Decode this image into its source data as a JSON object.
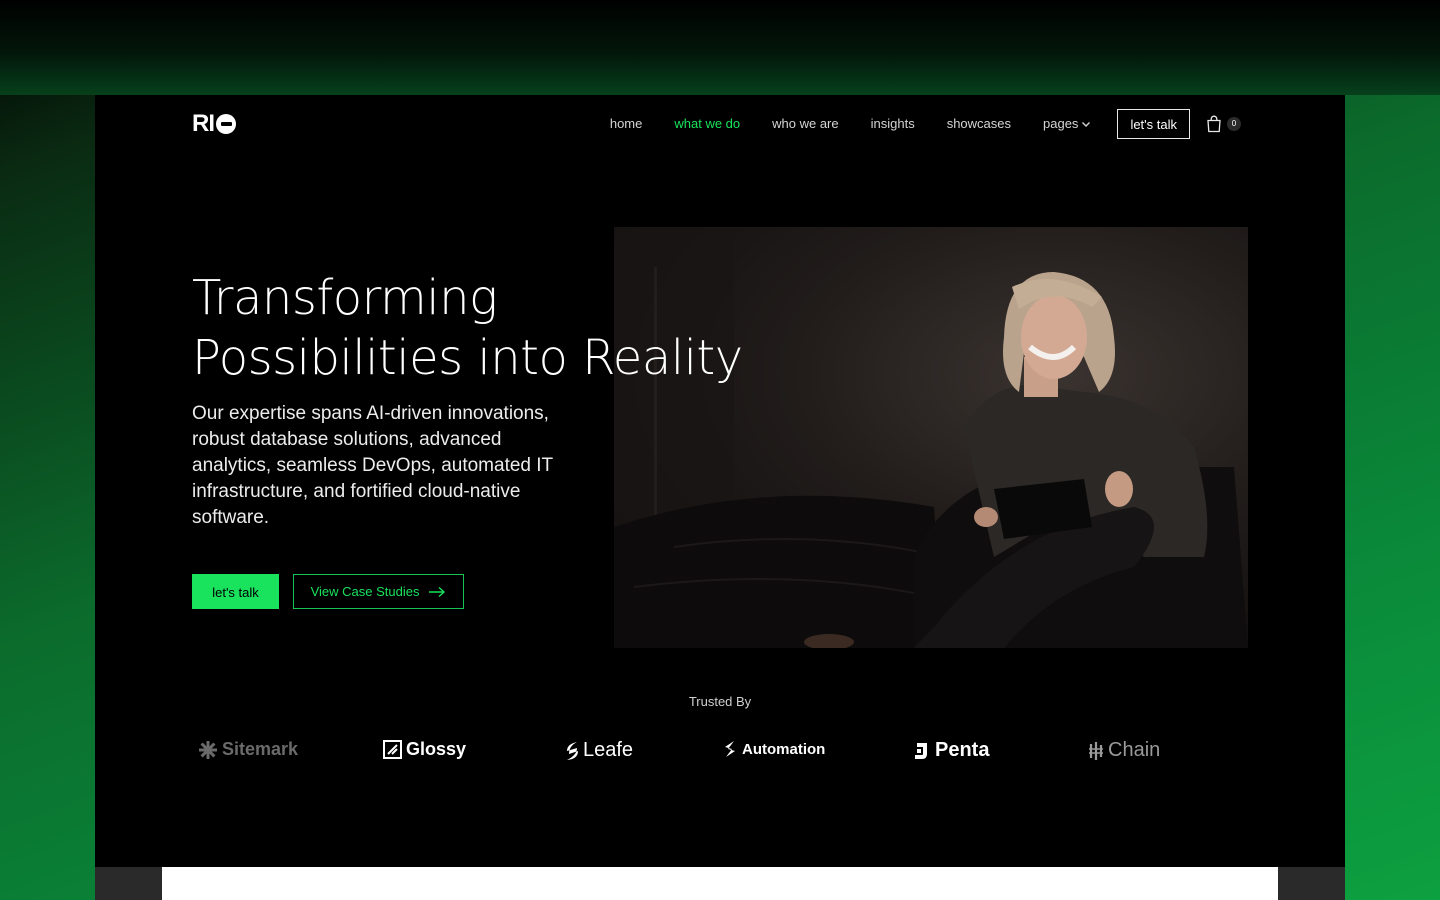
{
  "brand": {
    "logo_text": "RI"
  },
  "nav": {
    "items": [
      {
        "label": "home"
      },
      {
        "label": "what we do",
        "active": true
      },
      {
        "label": "who we are"
      },
      {
        "label": "insights"
      },
      {
        "label": "showcases"
      },
      {
        "label": "pages"
      }
    ],
    "cta_label": "let's talk",
    "cart_count": "0"
  },
  "hero": {
    "title_line1": "Transforming",
    "title_line2": "Possibilities into Reality",
    "description": "Our expertise spans AI-driven innovations, robust database solutions, advanced analytics, seamless DevOps, automated IT infrastructure, and fortified cloud-native software.",
    "primary_cta": "let's talk",
    "secondary_cta": "View Case Studies"
  },
  "trusted": {
    "heading": "Trusted By",
    "logos": [
      "Sitemark",
      "Glossy",
      "Leafe",
      "Automation",
      "Penta",
      "Chain"
    ]
  },
  "colors": {
    "accent": "#19e25c",
    "background": "#000000"
  }
}
